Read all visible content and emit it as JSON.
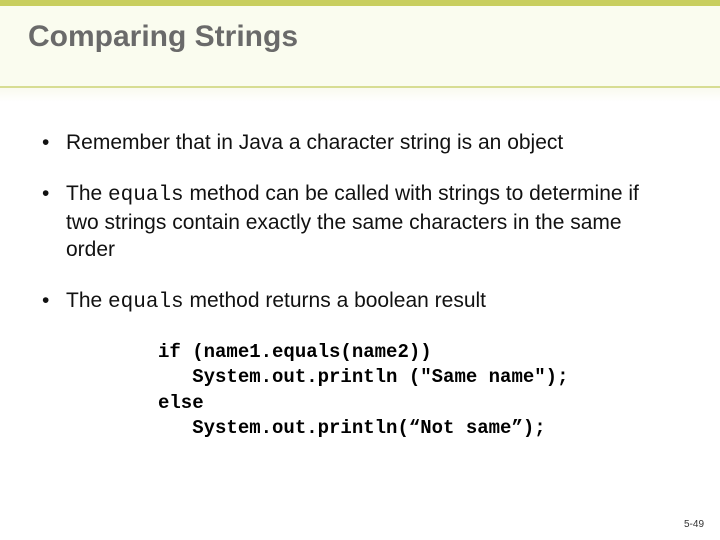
{
  "title": "Comparing Strings",
  "bullets": {
    "b1_pre": "Remember that in Java a character string is an object",
    "b2_pre": "The ",
    "b2_code": "equals",
    "b2_post": " method can be called with strings to determine if two strings contain exactly the same characters in the same order",
    "b3_pre": "The ",
    "b3_code": "equals",
    "b3_post": " method returns a boolean result"
  },
  "code": "if (name1.equals(name2))\n   System.out.println (\"Same name\");\nelse\n   System.out.println(“Not same”);",
  "pagenum": "5-49"
}
